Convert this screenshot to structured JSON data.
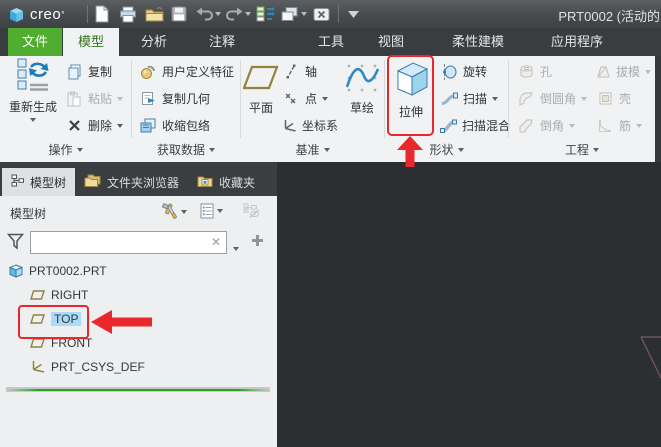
{
  "titlebar": {
    "logo_text": "creo",
    "logo_mark": "°",
    "document_title": "PRT0002 (活动的",
    "quick_access_icons": [
      "new-file",
      "print",
      "open",
      "save",
      "undo",
      "redo",
      "regenerate-list",
      "window-display",
      "close-window",
      "collapse-toolbar"
    ]
  },
  "tabs": {
    "items": [
      {
        "label": "文件"
      },
      {
        "label": "模型"
      },
      {
        "label": "分析"
      },
      {
        "label": "注释"
      },
      {
        "label": "工具"
      },
      {
        "label": "视图"
      },
      {
        "label": "柔性建模"
      },
      {
        "label": "应用程序"
      }
    ],
    "active": "模型"
  },
  "ribbon": {
    "operations": {
      "regenerate": "重新生成",
      "copy": "复制",
      "paste": "粘贴",
      "delete": "删除",
      "group_label": "操作"
    },
    "get_data": {
      "udf": "用户定义特征",
      "copy_geometry": "复制几何",
      "shrinkwrap": "收缩包络",
      "group_label": "获取数据"
    },
    "datum": {
      "plane": "平面",
      "axis": "轴",
      "point": "点",
      "csys": "坐标系",
      "sketch": "草绘",
      "group_label": "基准"
    },
    "shapes": {
      "extrude": "拉伸",
      "revolve": "旋转",
      "sweep": "扫描",
      "swept_blend": "扫描混合",
      "group_label": "形状"
    },
    "engineering": {
      "hole": "孔",
      "draft": "拔模",
      "round": "倒圆角",
      "shell": "壳",
      "chamfer": "倒角",
      "rib": "筋",
      "group_label": "工程"
    }
  },
  "navigator": {
    "tabs": [
      {
        "label": "模型树",
        "icon": "model-tree"
      },
      {
        "label": "文件夹浏览器",
        "icon": "folder-browser"
      },
      {
        "label": "收藏夹",
        "icon": "favorites"
      }
    ],
    "header": {
      "title": "模型树",
      "icons": [
        "tools",
        "display-settings",
        "show-hide-tree"
      ]
    },
    "filter": {
      "value": "",
      "icons": [
        "filter-funnel",
        "clear",
        "dropdown",
        "add"
      ]
    },
    "tree": {
      "items": [
        {
          "label": "PRT0002.PRT",
          "icon": "part",
          "level": 0
        },
        {
          "label": "RIGHT",
          "icon": "datum-plane",
          "level": 1
        },
        {
          "label": "TOP",
          "icon": "datum-plane",
          "level": 1,
          "selected": true
        },
        {
          "label": "FRONT",
          "icon": "datum-plane",
          "level": 1
        },
        {
          "label": "PRT_CSYS_DEF",
          "icon": "coordinate-system",
          "level": 1
        }
      ]
    }
  },
  "annotations": {
    "highlighted_ribbon_button": "拉伸",
    "highlighted_tree_item": "TOP",
    "color": "#e8282c"
  },
  "colors": {
    "accent_green": "#4fae30",
    "selection_blue": "#a9dcf8",
    "titlebar_gray": "#474b4d",
    "graphics_background": "#2c2f31",
    "annotation_red": "#e8282c"
  }
}
